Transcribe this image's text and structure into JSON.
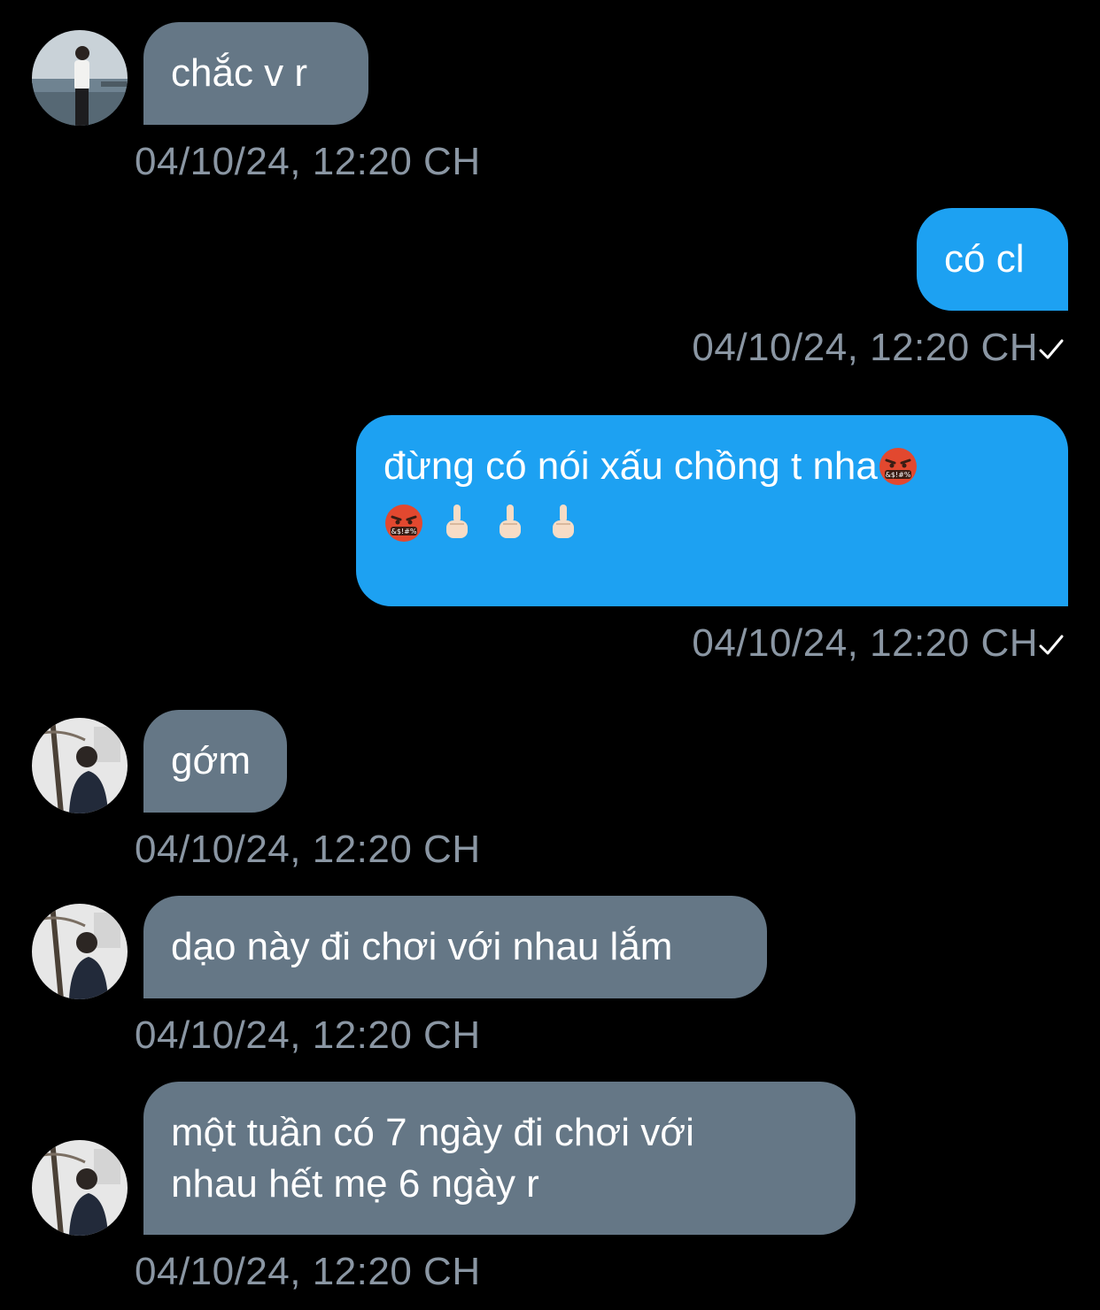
{
  "conversation": {
    "messages": [
      {
        "direction": "in",
        "lines": [
          "chắc v r"
        ],
        "time": "04/10/24, 12:20 CH",
        "avatar": "avatar-sea"
      },
      {
        "direction": "out",
        "lines": [
          "có cl"
        ],
        "time": "04/10/24, 12:20 CH",
        "status": "sent"
      },
      {
        "direction": "out",
        "lines": [
          "đừng có nói xấu chồng t nha"
        ],
        "emoji_inline": "face-with-symbols-icon",
        "emoji_row": [
          "face-with-symbols-icon",
          "middle-finger-icon",
          "middle-finger-icon",
          "middle-finger-icon"
        ],
        "time": "04/10/24, 12:20 CH",
        "status": "sent"
      },
      {
        "direction": "in",
        "lines": [
          "gớm"
        ],
        "time": "04/10/24, 12:20 CH",
        "avatar": "avatar-tree"
      },
      {
        "direction": "in",
        "lines": [
          "dạo này đi chơi với nhau lắm"
        ],
        "time": "04/10/24, 12:20 CH",
        "avatar": "avatar-tree"
      },
      {
        "direction": "in",
        "lines": [
          "một tuần có 7 ngày đi chơi với",
          "nhau hết mẹ 6 ngày r"
        ],
        "time": "04/10/24, 12:20 CH",
        "avatar": "avatar-tree"
      }
    ]
  },
  "colors": {
    "background": "#000000",
    "incoming_bubble": "#657786",
    "outgoing_bubble": "#1da1f2",
    "timestamp": "#8a96a3",
    "text": "#ffffff"
  }
}
